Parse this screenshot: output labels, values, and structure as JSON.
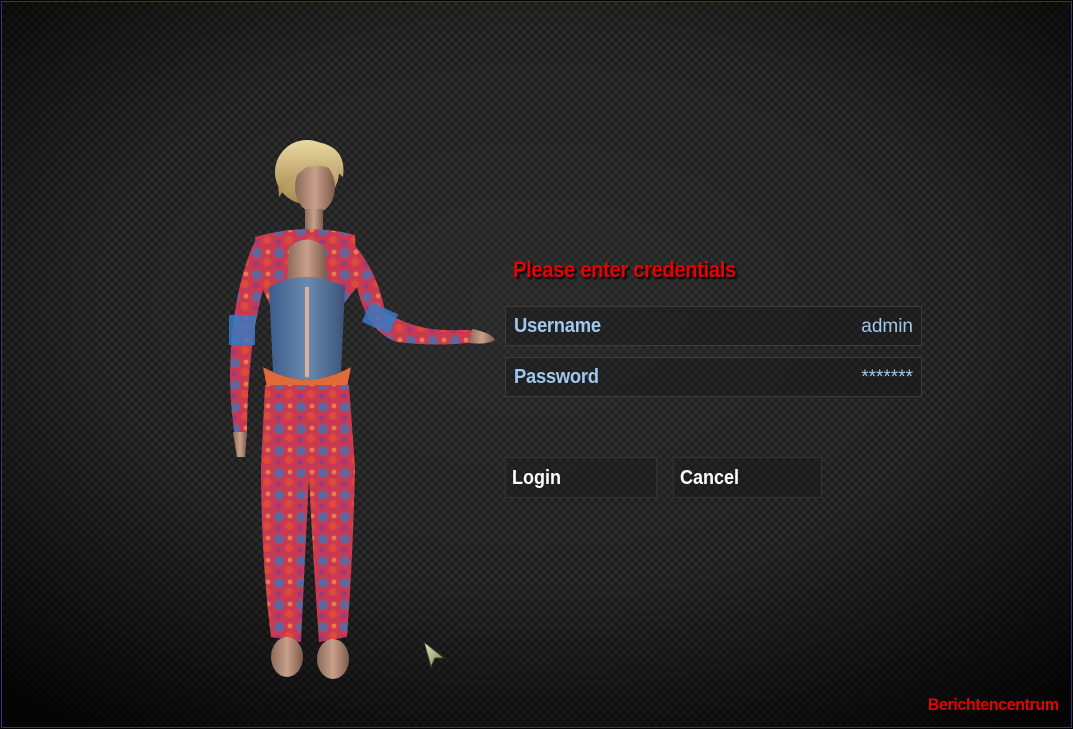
{
  "dialog": {
    "title": "Please enter credentials",
    "username": {
      "label": "Username",
      "value": "admin"
    },
    "password": {
      "label": "Password",
      "value": "*******"
    }
  },
  "buttons": {
    "login_label": "Login",
    "cancel_label": "Cancel"
  },
  "footer": {
    "label": "Berichtencentrum"
  },
  "colors": {
    "title": "#e50000",
    "field_text": "#9ec8ee",
    "button_text": "#ffffff",
    "footer": "#e50000",
    "background": "#1c1c1c"
  },
  "icons": {
    "cursor": "mouse-pointer-icon",
    "figure": "female-avatar-figure"
  }
}
